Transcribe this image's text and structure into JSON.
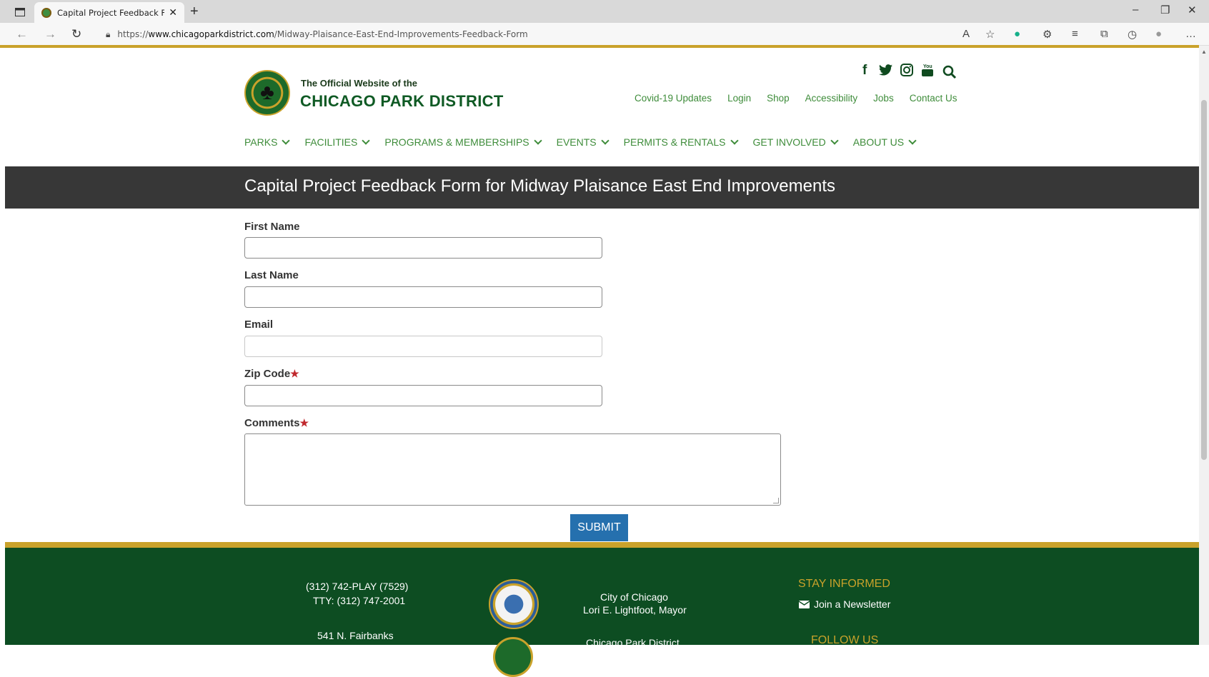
{
  "browser": {
    "tab_title": "Capital Project Feedback Form fo",
    "url_prefix": "https://",
    "url_host": "www.chicagoparkdistrict.com",
    "url_path": "/Midway-Plaisance-East-End-Improvements-Feedback-Form"
  },
  "header": {
    "official_line": "The Official Website of the",
    "site_name": "CHICAGO PARK DISTRICT",
    "social_icons": [
      "facebook-icon",
      "twitter-icon",
      "instagram-icon",
      "youtube-icon",
      "search-icon"
    ],
    "top_links": [
      "Covid-19 Updates",
      "Login",
      "Shop",
      "Accessibility",
      "Jobs",
      "Contact Us"
    ]
  },
  "nav": {
    "items": [
      "PARKS",
      "FACILITIES",
      "PROGRAMS & MEMBERSHIPS",
      "EVENTS",
      "PERMITS & RENTALS",
      "GET INVOLVED",
      "ABOUT US"
    ]
  },
  "page": {
    "title": "Capital Project Feedback Form for Midway Plaisance East End Improvements"
  },
  "form": {
    "first_name_label": "First Name",
    "last_name_label": "Last Name",
    "email_label": "Email",
    "zip_label": "Zip Code",
    "comments_label": "Comments",
    "required_mark": "★",
    "first_name_value": "",
    "last_name_value": "",
    "email_value": "",
    "zip_value": "",
    "comments_value": "",
    "submit_label": "SUBMIT"
  },
  "footer": {
    "phone": "(312) 742-PLAY (7529)",
    "tty": "TTY: (312) 747-2001",
    "address": "541 N. Fairbanks",
    "city_line": "City of Chicago",
    "mayor_line": "Lori E. Lightfoot, Mayor",
    "cpd_line": "Chicago Park District",
    "stay_informed": "STAY INFORMED",
    "newsletter": "Join a Newsletter",
    "follow_us": "FOLLOW US"
  },
  "colors": {
    "brand_green": "#0f5a24",
    "link_green": "#3e8c3a",
    "gold": "#c9a22b",
    "title_band": "#373737",
    "submit_blue": "#2570ae",
    "footer_green": "#0d4d22"
  }
}
